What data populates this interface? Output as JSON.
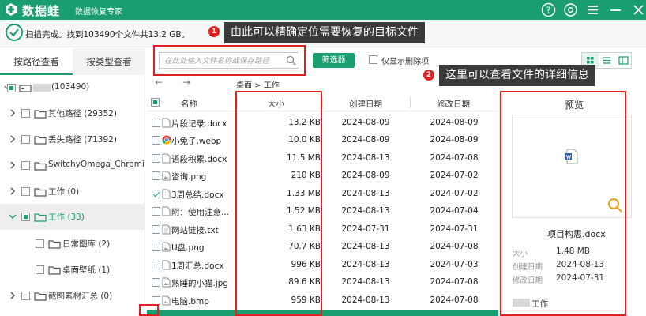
{
  "app": {
    "name": "数据蛙",
    "subtitle": "数据恢复专家",
    "brand_color": "#1a9e6f"
  },
  "titlebar": {
    "icons": [
      "help-icon",
      "settings-icon",
      "menu-icon",
      "minimize-icon"
    ]
  },
  "status": {
    "text": "扫描完成。找到103490个文件共13.2 GB。"
  },
  "annotations": [
    {
      "number": "1",
      "text": "由此可以精确定位需要恢复的目标文件"
    },
    {
      "number": "2",
      "text": "这里可以查看文件的详细信息"
    }
  ],
  "left_tabs": [
    {
      "label": "按路径查看",
      "active": true
    },
    {
      "label": "按类型查看",
      "active": false
    }
  ],
  "tree": [
    {
      "label": "(103490)",
      "icon": "drive-icon"
    },
    {
      "label": "其他路径 (29352)",
      "icon": "folder-icon"
    },
    {
      "label": "丢失路径 (71392)",
      "icon": "folder-icon"
    },
    {
      "label": "SwitchyOmega_Chromium",
      "icon": "folder-icon"
    },
    {
      "label": "工作 (0)",
      "icon": "folder-icon"
    },
    {
      "label": "工作 (33)",
      "icon": "folder-icon"
    },
    {
      "label": "日常图库 (2)",
      "icon": "folder-icon"
    },
    {
      "label": "桌面壁纸 (1)",
      "icon": "folder-icon"
    },
    {
      "label": "截图素材汇总 (0)",
      "icon": "folder-icon"
    }
  ],
  "toolbar": {
    "search_placeholder": "在此处输入文件名称或保存路径",
    "filter_label": "筛选器",
    "deleted_only_label": "仅显示删除项"
  },
  "pathbar": {
    "path": "桌面 > 工作"
  },
  "table": {
    "headers": [
      "名称",
      "大小",
      "创建日期",
      "修改日期"
    ],
    "rows": [
      {
        "name": "片段记录.docx",
        "size": "13.2 KB",
        "created": "2024-08-09",
        "modified": "2024-08-09",
        "icon": "word-file-icon",
        "checked": false
      },
      {
        "name": "小兔子.webp",
        "size": "10.0 KB",
        "created": "2024-08-09",
        "modified": "2024-08-09",
        "icon": "chrome-file-icon",
        "checked": false
      },
      {
        "name": "语段积累.docx",
        "size": "11.5 MB",
        "created": "2024-08-13",
        "modified": "2024-07-08",
        "icon": "word-file-icon",
        "checked": false
      },
      {
        "name": "咨询.png",
        "size": "210 KB",
        "created": "2024-08-09",
        "modified": "2024-07-02",
        "icon": "image-file-icon",
        "checked": false
      },
      {
        "name": "3周总结.docx",
        "size": "1.33 MB",
        "created": "2024-08-13",
        "modified": "2024-07-02",
        "icon": "word-file-icon",
        "checked": true
      },
      {
        "name": "附：使用注意...",
        "size": "1.52 MB",
        "created": "2024-08-13",
        "modified": "2024-07-04",
        "icon": "word-file-icon",
        "checked": false
      },
      {
        "name": "网站链接.txt",
        "size": "1.63 KB",
        "created": "2024-07-31",
        "modified": "2024-07-31",
        "icon": "text-file-icon",
        "checked": false
      },
      {
        "name": "U盘.png",
        "size": "70.7 KB",
        "created": "2024-08-13",
        "modified": "2024-07-08",
        "icon": "image-file-icon",
        "checked": false
      },
      {
        "name": "1周汇总.docx",
        "size": "996 KB",
        "created": "2024-08-13",
        "modified": "2024-07-03",
        "icon": "word-file-icon",
        "checked": false
      },
      {
        "name": "熟睡的小猫.jpg",
        "size": "89.6 KB",
        "created": "2024-08-13",
        "modified": "2024-07-08",
        "icon": "image-file-icon",
        "checked": false
      },
      {
        "name": "电脑.bmp",
        "size": "959 KB",
        "created": "2024-08-13",
        "modified": "2024-07-08",
        "icon": "image-file-icon",
        "checked": false
      }
    ]
  },
  "preview": {
    "title": "预览",
    "file_name": "项目构思.docx",
    "fields": [
      {
        "label": "大小",
        "value": "1.48 MB"
      },
      {
        "label": "创建日期",
        "value": "2024-08-13"
      },
      {
        "label": "修改日期",
        "value": "2024-07-31"
      },
      {
        "label": "路径",
        "value": "工作"
      }
    ]
  }
}
